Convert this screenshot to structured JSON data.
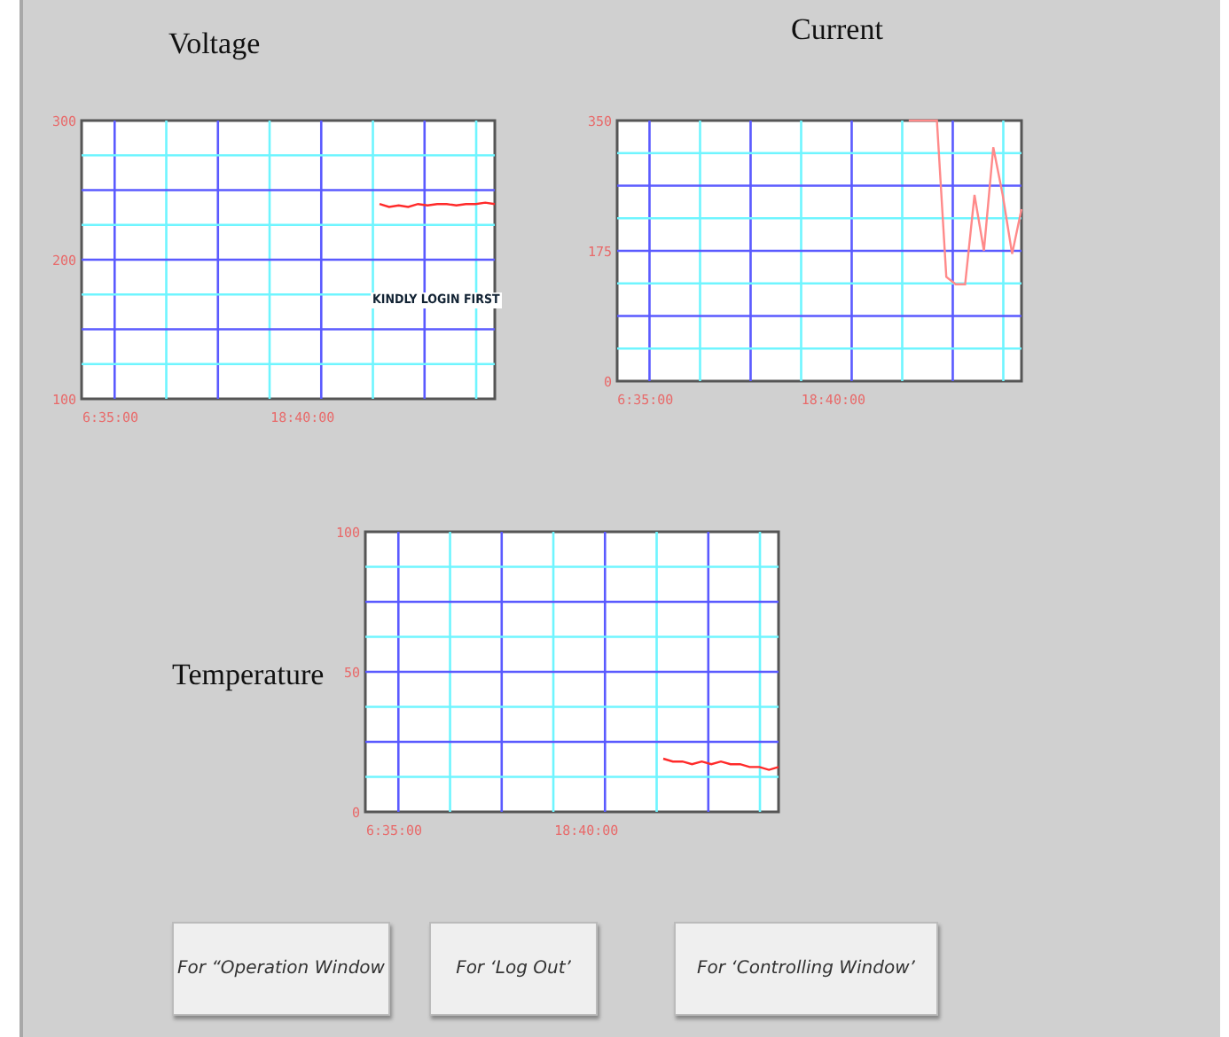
{
  "charts": [
    {
      "notice": "KINDLY  LOGIN FIRST",
      "chart_data": {
        "type": "line",
        "title": "Voltage",
        "grid": true,
        "ylim": [
          100,
          300
        ],
        "yticks": [
          100,
          200,
          300
        ],
        "categories": [
          "6:35:00",
          null,
          null,
          null,
          null,
          null,
          null,
          null,
          null,
          null,
          null,
          null,
          null,
          null,
          null,
          null,
          null,
          null,
          null,
          null,
          "18:40:00",
          null,
          null,
          null,
          null,
          null,
          null,
          null,
          null,
          null,
          null,
          null,
          null,
          null,
          null,
          null,
          null,
          null,
          null,
          null,
          null
        ],
        "values": [
          null,
          null,
          null,
          null,
          null,
          null,
          null,
          null,
          null,
          null,
          null,
          null,
          null,
          null,
          null,
          null,
          null,
          null,
          null,
          null,
          null,
          null,
          null,
          null,
          null,
          null,
          null,
          null,
          240,
          238,
          239,
          238,
          240,
          239,
          240,
          240,
          239,
          240,
          240,
          241,
          240
        ]
      }
    },
    {
      "chart_data": {
        "type": "line",
        "title": "Current",
        "grid": true,
        "ylim": [
          0,
          350
        ],
        "yticks": [
          0,
          175,
          350
        ],
        "categories": [
          "6:35:00",
          null,
          null,
          null,
          null,
          null,
          null,
          null,
          null,
          null,
          null,
          null,
          null,
          null,
          null,
          null,
          null,
          null,
          null,
          null,
          "18:40:00",
          null,
          null,
          null,
          null,
          null,
          null,
          null,
          null,
          null,
          null,
          null,
          null,
          null,
          null,
          null,
          null,
          null,
          null,
          null,
          null
        ],
        "values": [
          null,
          null,
          null,
          null,
          null,
          null,
          null,
          null,
          null,
          null,
          null,
          null,
          null,
          null,
          null,
          null,
          null,
          null,
          null,
          null,
          null,
          null,
          null,
          null,
          null,
          null,
          null,
          null,
          350,
          350,
          350,
          350,
          140,
          130,
          130,
          250,
          175,
          314,
          250,
          171,
          231
        ]
      }
    },
    {
      "chart_data": {
        "type": "line",
        "title": "Temperature",
        "grid": true,
        "ylim": [
          0,
          100
        ],
        "yticks": [
          0,
          50,
          100
        ],
        "categories": [
          "6:35:00",
          null,
          null,
          null,
          null,
          null,
          null,
          null,
          null,
          null,
          null,
          null,
          null,
          null,
          null,
          null,
          null,
          null,
          null,
          null,
          "18:40:00",
          null,
          null,
          null,
          null,
          null,
          null,
          null,
          null,
          null,
          null,
          null,
          null,
          null,
          null,
          null,
          null,
          null,
          null,
          null,
          null
        ],
        "values": [
          null,
          null,
          null,
          null,
          null,
          null,
          null,
          null,
          null,
          null,
          null,
          null,
          null,
          null,
          null,
          null,
          null,
          null,
          null,
          null,
          null,
          null,
          null,
          null,
          null,
          null,
          null,
          null,
          19,
          18,
          18,
          17,
          18,
          17,
          18,
          17,
          17,
          16,
          16,
          15,
          16
        ]
      }
    }
  ],
  "buttons": [
    "For  “Operation Window",
    "For  ‘Log Out’",
    "For  ‘Controlling Window’"
  ]
}
